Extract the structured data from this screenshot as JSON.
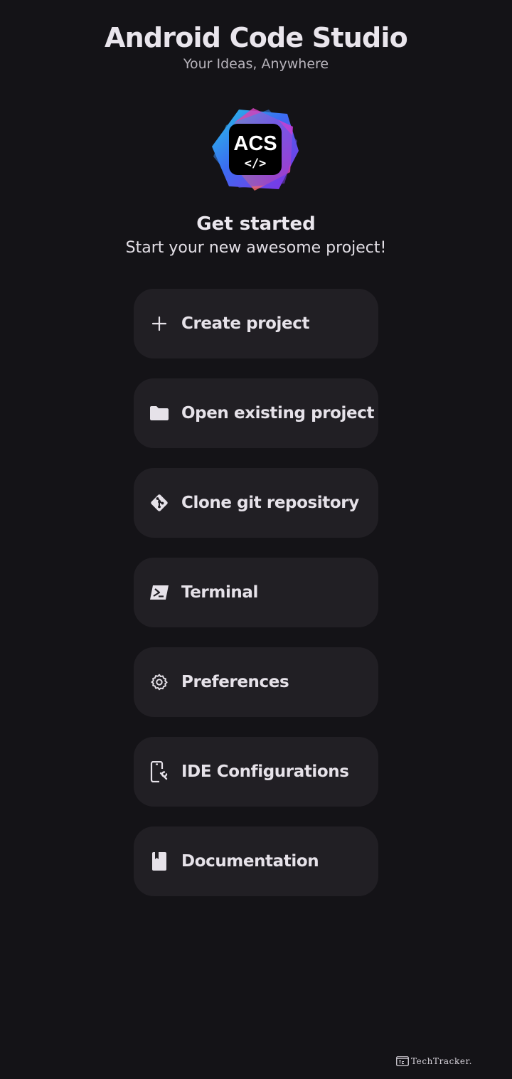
{
  "header": {
    "title": "Android Code Studio",
    "subtitle": "Your Ideas, Anywhere"
  },
  "logo": {
    "text": "ACS",
    "code_glyph": "</>"
  },
  "intro": {
    "title": "Get started",
    "subtitle": "Start your new awesome project!"
  },
  "menu": {
    "items": [
      {
        "label": "Create project",
        "icon": "plus-icon"
      },
      {
        "label": "Open existing project",
        "icon": "folder-icon"
      },
      {
        "label": "Clone git repository",
        "icon": "git-icon"
      },
      {
        "label": "Terminal",
        "icon": "terminal-icon"
      },
      {
        "label": "Preferences",
        "icon": "gear-icon"
      },
      {
        "label": "IDE Configurations",
        "icon": "phone-settings-icon"
      },
      {
        "label": "Documentation",
        "icon": "book-icon"
      }
    ]
  },
  "watermark": {
    "text": "TechTracker."
  },
  "colors": {
    "background": "#141317",
    "card": "#211f24",
    "text": "#e6e2e9"
  }
}
